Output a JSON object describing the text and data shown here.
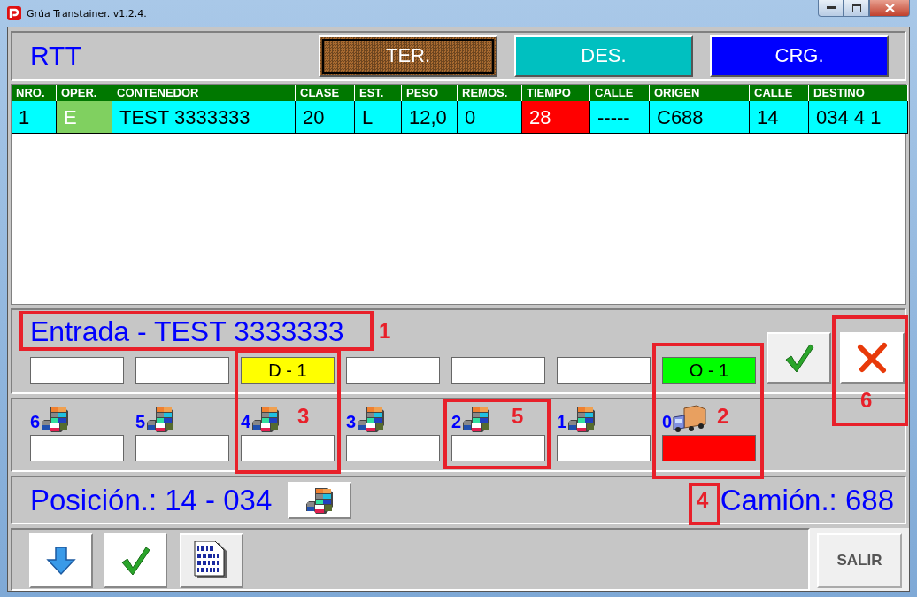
{
  "window": {
    "title": "Grúa Transtainer. v1.2.4."
  },
  "header": {
    "label": "RTT",
    "modes": [
      {
        "label": "TER.",
        "selected": true,
        "color": "#a86a30"
      },
      {
        "label": "DES.",
        "selected": false,
        "color": "#00c0c0"
      },
      {
        "label": "CRG.",
        "selected": false,
        "color": "#0000ff"
      }
    ]
  },
  "table": {
    "columns": [
      "NRO.",
      "OPER.",
      "CONTENEDOR",
      "CLASE",
      "EST.",
      "PESO",
      "REMOS.",
      "TIEMPO",
      "CALLE",
      "ORIGEN",
      "CALLE",
      "DESTINO"
    ],
    "rows": [
      {
        "cells": [
          {
            "text": "1"
          },
          {
            "text": "E",
            "color": "#80d060"
          },
          {
            "text": "TEST 3333333"
          },
          {
            "text": "20"
          },
          {
            "text": "L"
          },
          {
            "text": "12,0"
          },
          {
            "text": "0"
          },
          {
            "text": "28",
            "color": "#ff0000"
          },
          {
            "text": "-----"
          },
          {
            "text": "C688"
          },
          {
            "text": "14"
          },
          {
            "text": "034 4 1"
          }
        ]
      }
    ]
  },
  "operation": {
    "title": "Entrada - TEST 3333333",
    "slots": [
      {
        "color": "#ffffff"
      },
      {
        "color": "#ffffff"
      },
      {
        "value": "D - 1",
        "color": "#ffff00"
      },
      {
        "color": "#ffffff"
      },
      {
        "color": "#ffffff"
      },
      {
        "color": "#ffffff"
      },
      {
        "value": "O - 1",
        "color": "#00ff00"
      }
    ]
  },
  "tiers": [
    {
      "label": "6",
      "kind": "stack",
      "color": "#ffffff"
    },
    {
      "label": "5",
      "kind": "stack",
      "color": "#ffffff"
    },
    {
      "label": "4",
      "kind": "stack",
      "color": "#ffffff"
    },
    {
      "label": "3",
      "kind": "stack",
      "color": "#ffffff"
    },
    {
      "label": "2",
      "kind": "stack",
      "color": "#ffffff"
    },
    {
      "label": "1",
      "kind": "stack",
      "color": "#ffffff"
    },
    {
      "label": "0",
      "kind": "truck",
      "color": "#ff0000"
    }
  ],
  "position": "Posición.: 14 - 034",
  "truck": "Camión.: 688",
  "exit_button": "SALIR",
  "annotations": [
    {
      "label": "1"
    },
    {
      "label": "6"
    },
    {
      "label": "3"
    },
    {
      "label": "5"
    },
    {
      "label": "2"
    },
    {
      "label": "4"
    }
  ]
}
